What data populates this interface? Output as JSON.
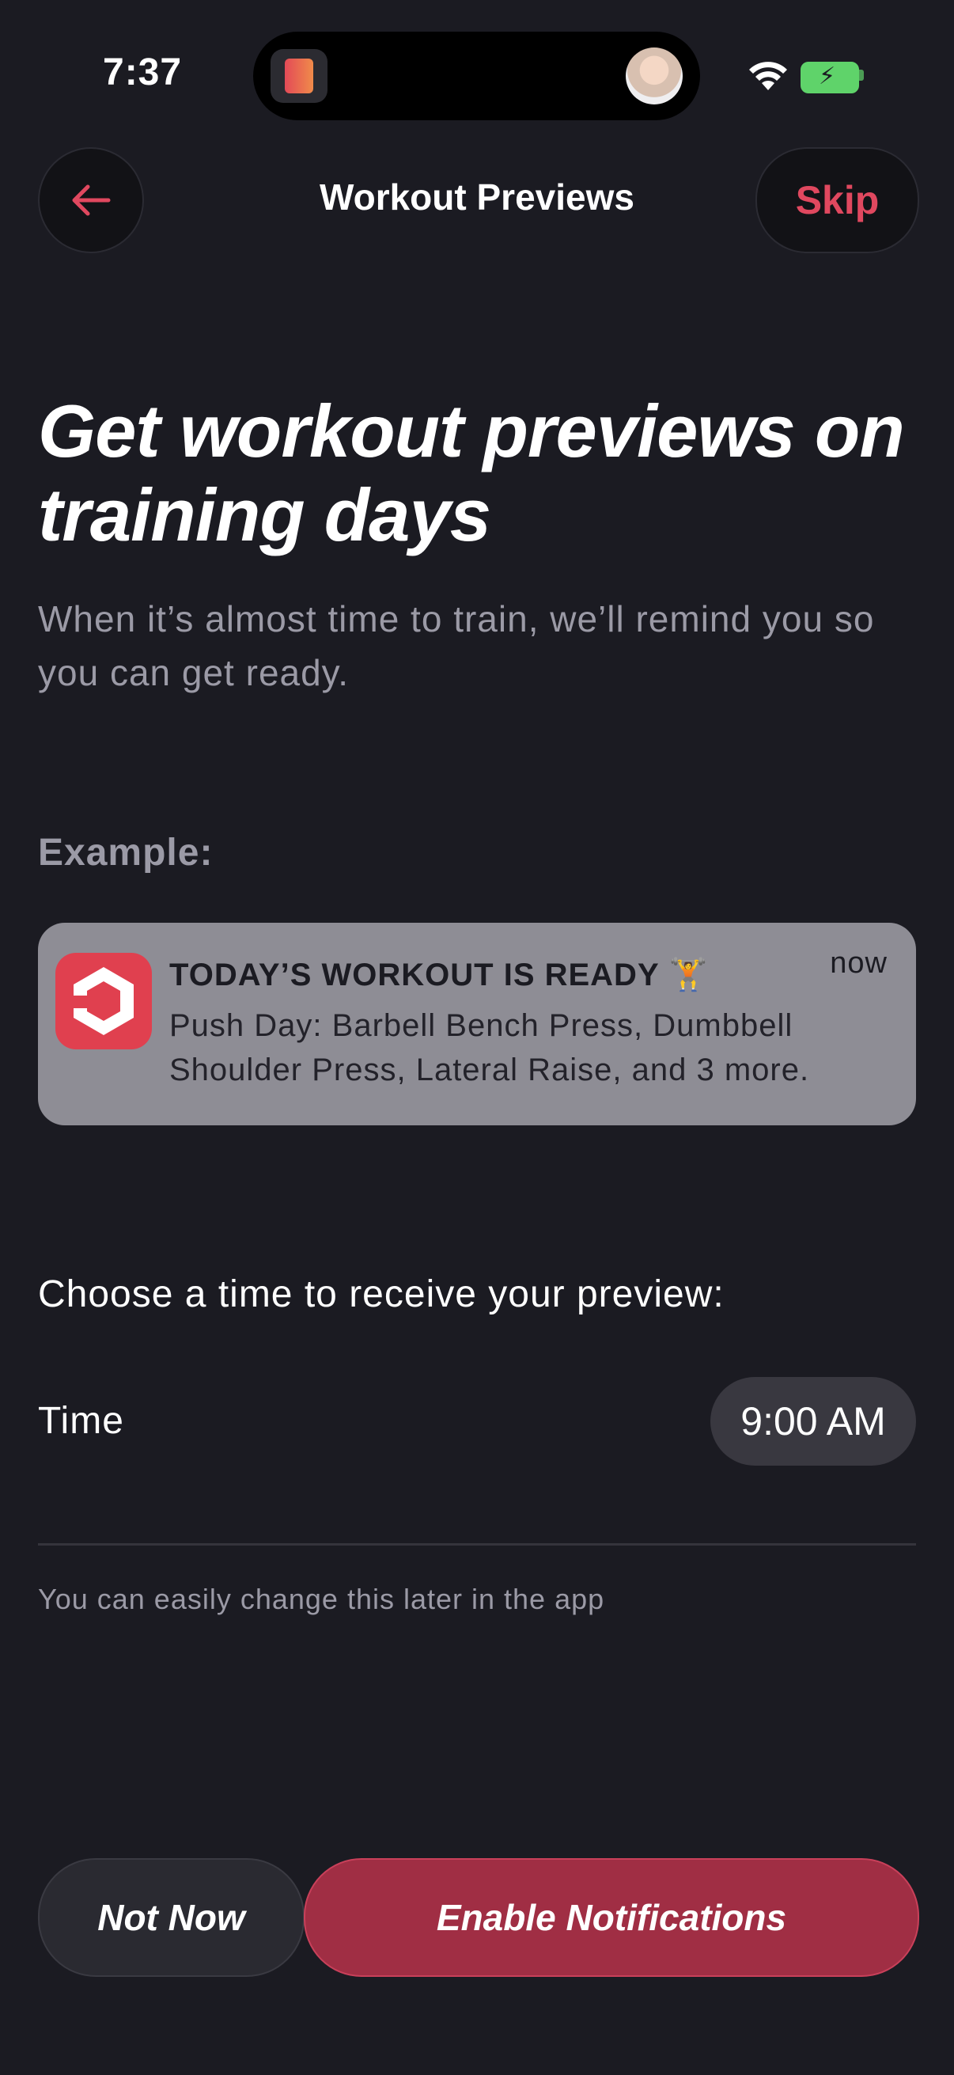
{
  "status_bar": {
    "time": "7:37",
    "icons": [
      "app-activity-icon",
      "avatar",
      "wifi-icon",
      "battery-charging-icon"
    ]
  },
  "header": {
    "title": "Workout Previews",
    "skip_label": "Skip",
    "back_icon": "arrow-left-icon"
  },
  "hero": {
    "title": "Get workout previews on training days",
    "subtitle": "When it’s almost time to train, we’ll remind you so you can get ready."
  },
  "example": {
    "label": "Example:",
    "notification": {
      "title": "TODAY’S WORKOUT IS READY 🏋",
      "time": "now",
      "body": "Push Day: Barbell Bench Press, Dumbbell Shoulder Press, Lateral Raise, and 3 more."
    }
  },
  "schedule": {
    "prompt": "Choose a time to receive your preview:",
    "time_label": "Time",
    "time_value": "9:00 AM",
    "hint": "You can easily change this later in the app"
  },
  "actions": {
    "not_now": "Not Now",
    "enable": "Enable Notifications"
  },
  "colors": {
    "background": "#1b1b22",
    "accent": "#e0485f",
    "primary_button": "#a02e44"
  }
}
